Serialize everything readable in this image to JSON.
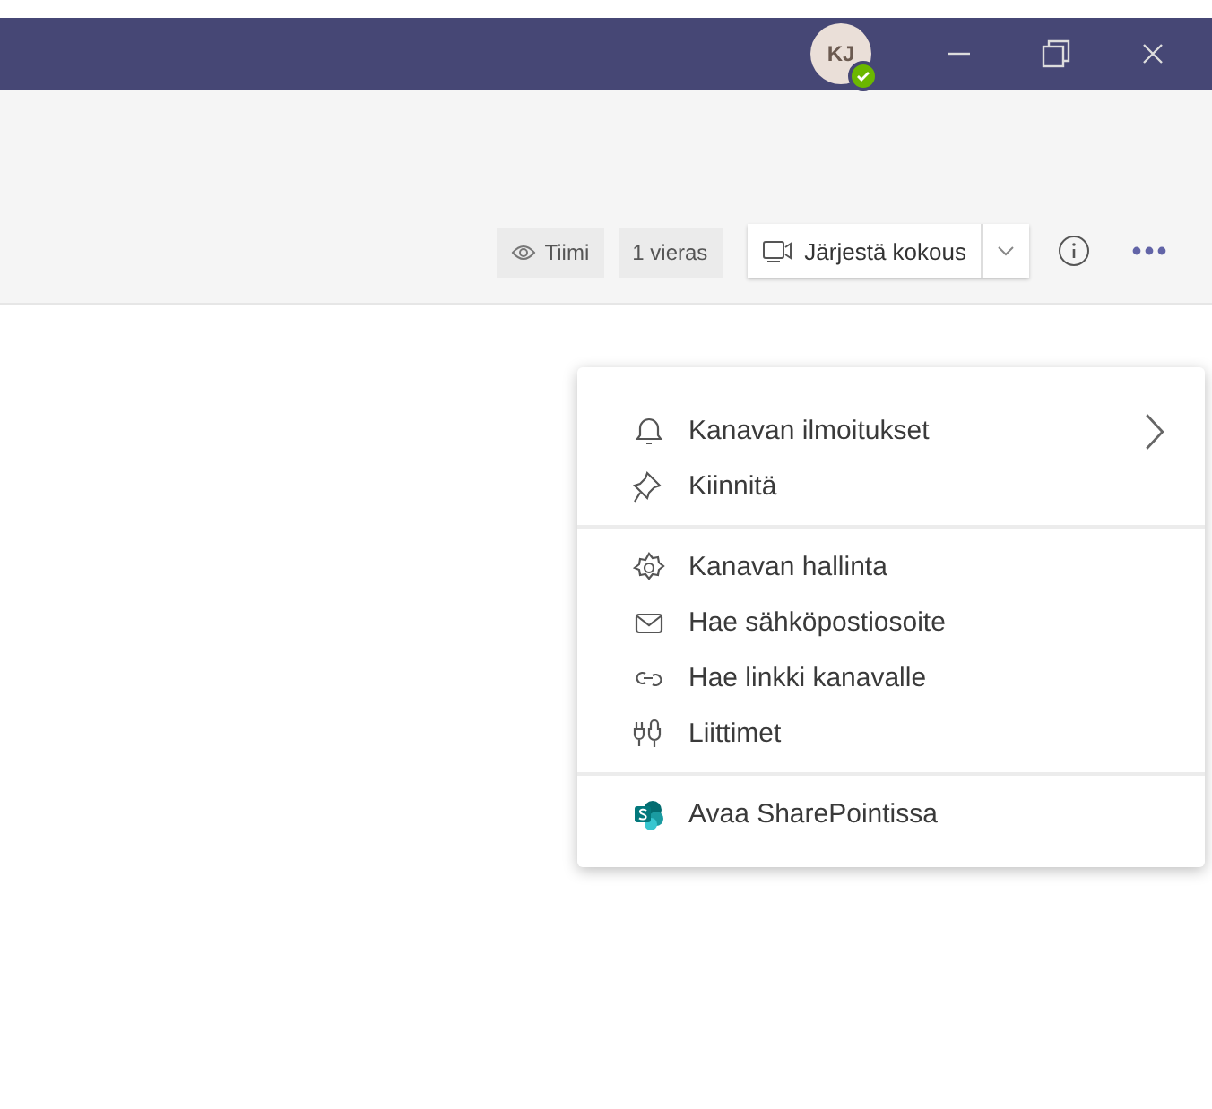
{
  "title_bar": {
    "avatar_initials": "KJ",
    "available": true
  },
  "toolbar": {
    "team_label": "Tiimi",
    "guest_label": "1 vieras",
    "meeting_button": "Järjestä kokous"
  },
  "menu": {
    "groups": [
      [
        {
          "label": "Kanavan ilmoitukset",
          "submenu": true
        },
        {
          "label": "Kiinnitä",
          "submenu": false
        }
      ],
      [
        {
          "label": "Kanavan hallinta",
          "submenu": false
        },
        {
          "label": "Hae sähköpostiosoite",
          "submenu": false
        },
        {
          "label": "Hae linkki kanavalle",
          "submenu": false
        },
        {
          "label": "Liittimet",
          "submenu": false
        }
      ],
      [
        {
          "label": "Avaa SharePointissa",
          "submenu": false
        }
      ]
    ]
  }
}
